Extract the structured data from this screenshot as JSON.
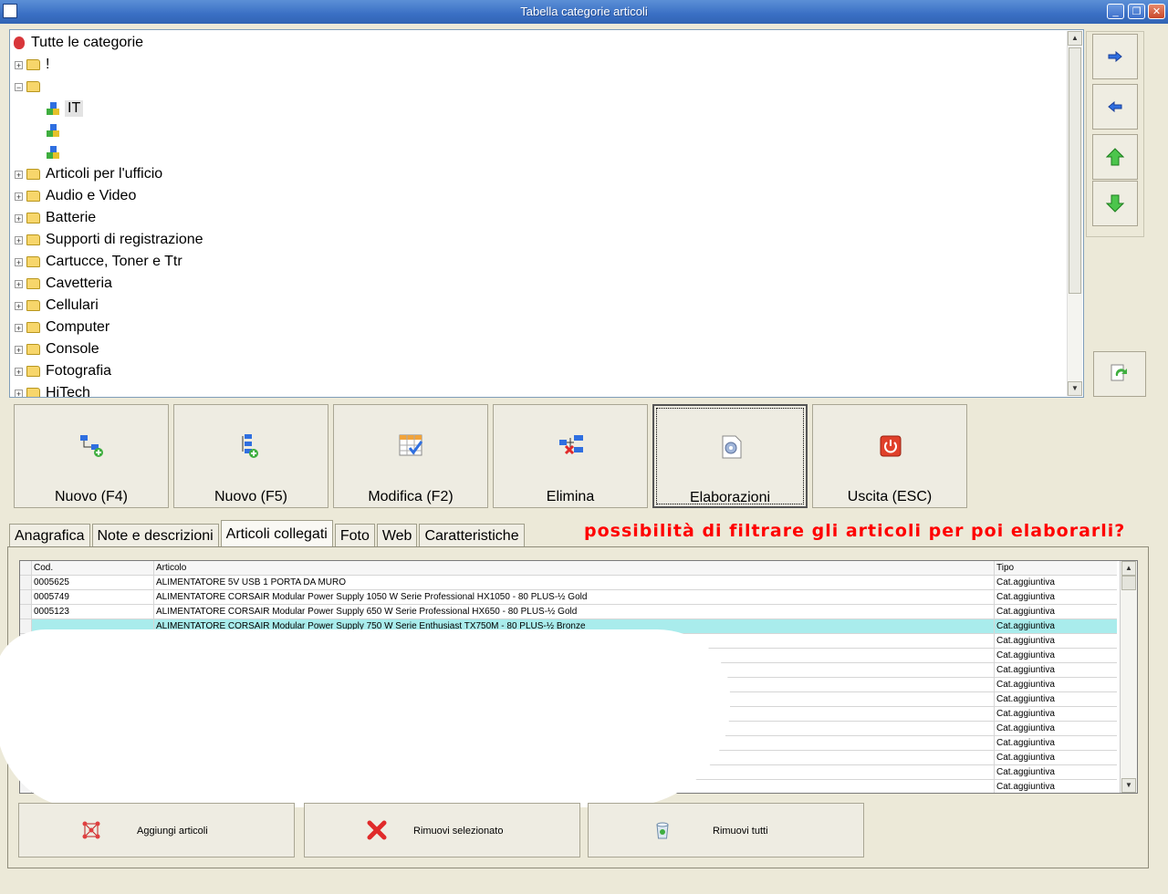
{
  "window": {
    "title": "Tabella categorie articoli"
  },
  "tree": {
    "root_label": "Tutte le categorie",
    "items": [
      {
        "label": "!",
        "expanded": false
      },
      {
        "label": "",
        "expanded": true
      },
      {
        "label": "IT",
        "child": true
      },
      {
        "label": "",
        "child": true
      },
      {
        "label": "",
        "child": true
      },
      {
        "label": "Articoli per l'ufficio",
        "expanded": false
      },
      {
        "label": "Audio e Video",
        "expanded": false
      },
      {
        "label": "Batterie",
        "expanded": false
      },
      {
        "label": "Supporti di registrazione",
        "expanded": false
      },
      {
        "label": "Cartucce, Toner e Ttr",
        "expanded": false
      },
      {
        "label": "Cavetteria",
        "expanded": false
      },
      {
        "label": "Cellulari",
        "expanded": false
      },
      {
        "label": "Computer",
        "expanded": false
      },
      {
        "label": "Console",
        "expanded": false
      },
      {
        "label": "Fotografia",
        "expanded": false
      },
      {
        "label": "HiTech",
        "expanded": false
      }
    ]
  },
  "side_buttons": {
    "icons": [
      "arrow-right-icon",
      "arrow-left-icon",
      "arrow-up-icon",
      "arrow-down-icon",
      "refresh-icon"
    ]
  },
  "toolbar": {
    "buttons": [
      {
        "label": "Nuovo (F4)",
        "icon": "new-tree-icon"
      },
      {
        "label": "Nuovo (F5)",
        "icon": "new-child-icon"
      },
      {
        "label": "Modifica (F2)",
        "icon": "edit-icon"
      },
      {
        "label": "Elimina",
        "icon": "delete-icon"
      },
      {
        "label": "Elaborazioni",
        "icon": "process-icon"
      },
      {
        "label": "Uscita (ESC)",
        "icon": "exit-icon"
      }
    ]
  },
  "tabs": [
    {
      "label": "Anagrafica"
    },
    {
      "label": "Note e descrizioni"
    },
    {
      "label": "Articoli collegati",
      "selected": true
    },
    {
      "label": "Foto"
    },
    {
      "label": "Web"
    },
    {
      "label": "Caratteristiche"
    }
  ],
  "annotation": "possibilità di filtrare gli articoli per poi elaborarli?",
  "grid": {
    "columns": [
      "Cod.",
      "Articolo",
      "Tipo"
    ],
    "rows": [
      {
        "code": "0005625",
        "article": "ALIMENTATORE 5V USB 1 PORTA DA MURO",
        "type": "Cat.aggiuntiva"
      },
      {
        "code": "0005749",
        "article": "ALIMENTATORE CORSAIR Modular Power Supply 1050 W Serie Professional HX1050 - 80 PLUS-½ Gold",
        "type": "Cat.aggiuntiva"
      },
      {
        "code": "0005123",
        "article": "ALIMENTATORE CORSAIR Modular Power Supply 650 W Serie Professional HX650 - 80 PLUS-½ Gold",
        "type": "Cat.aggiuntiva"
      },
      {
        "code": "",
        "article": "ALIMENTATORE CORSAIR Modular Power Supply 750 W Serie Enthusiast TX750M - 80 PLUS-½ Bronze",
        "type": "Cat.aggiuntiva",
        "selected": true
      },
      {
        "code": "",
        "article": "",
        "type": "Cat.aggiuntiva"
      },
      {
        "code": "",
        "article": "",
        "type": "Cat.aggiuntiva"
      },
      {
        "code": "",
        "article": "",
        "type": "Cat.aggiuntiva"
      },
      {
        "code": "",
        "article": "",
        "type": "Cat.aggiuntiva"
      },
      {
        "code": "",
        "article": "",
        "type": "Cat.aggiuntiva"
      },
      {
        "code": "",
        "article": "",
        "type": "Cat.aggiuntiva"
      },
      {
        "code": "",
        "article": "",
        "type": "Cat.aggiuntiva"
      },
      {
        "code": "",
        "article": "",
        "type": "Cat.aggiuntiva"
      },
      {
        "code": "",
        "article": "",
        "type": "Cat.aggiuntiva"
      },
      {
        "code": "",
        "article": "",
        "type": "Cat.aggiuntiva"
      },
      {
        "code": "",
        "article": "",
        "type": "Cat.aggiuntiva"
      }
    ]
  },
  "actions": [
    {
      "label": "Aggiungi articoli",
      "icon": "add-articles-icon"
    },
    {
      "label": "Rimuovi selezionato",
      "icon": "remove-selected-icon"
    },
    {
      "label": "Rimuovi tutti",
      "icon": "remove-all-icon"
    }
  ]
}
